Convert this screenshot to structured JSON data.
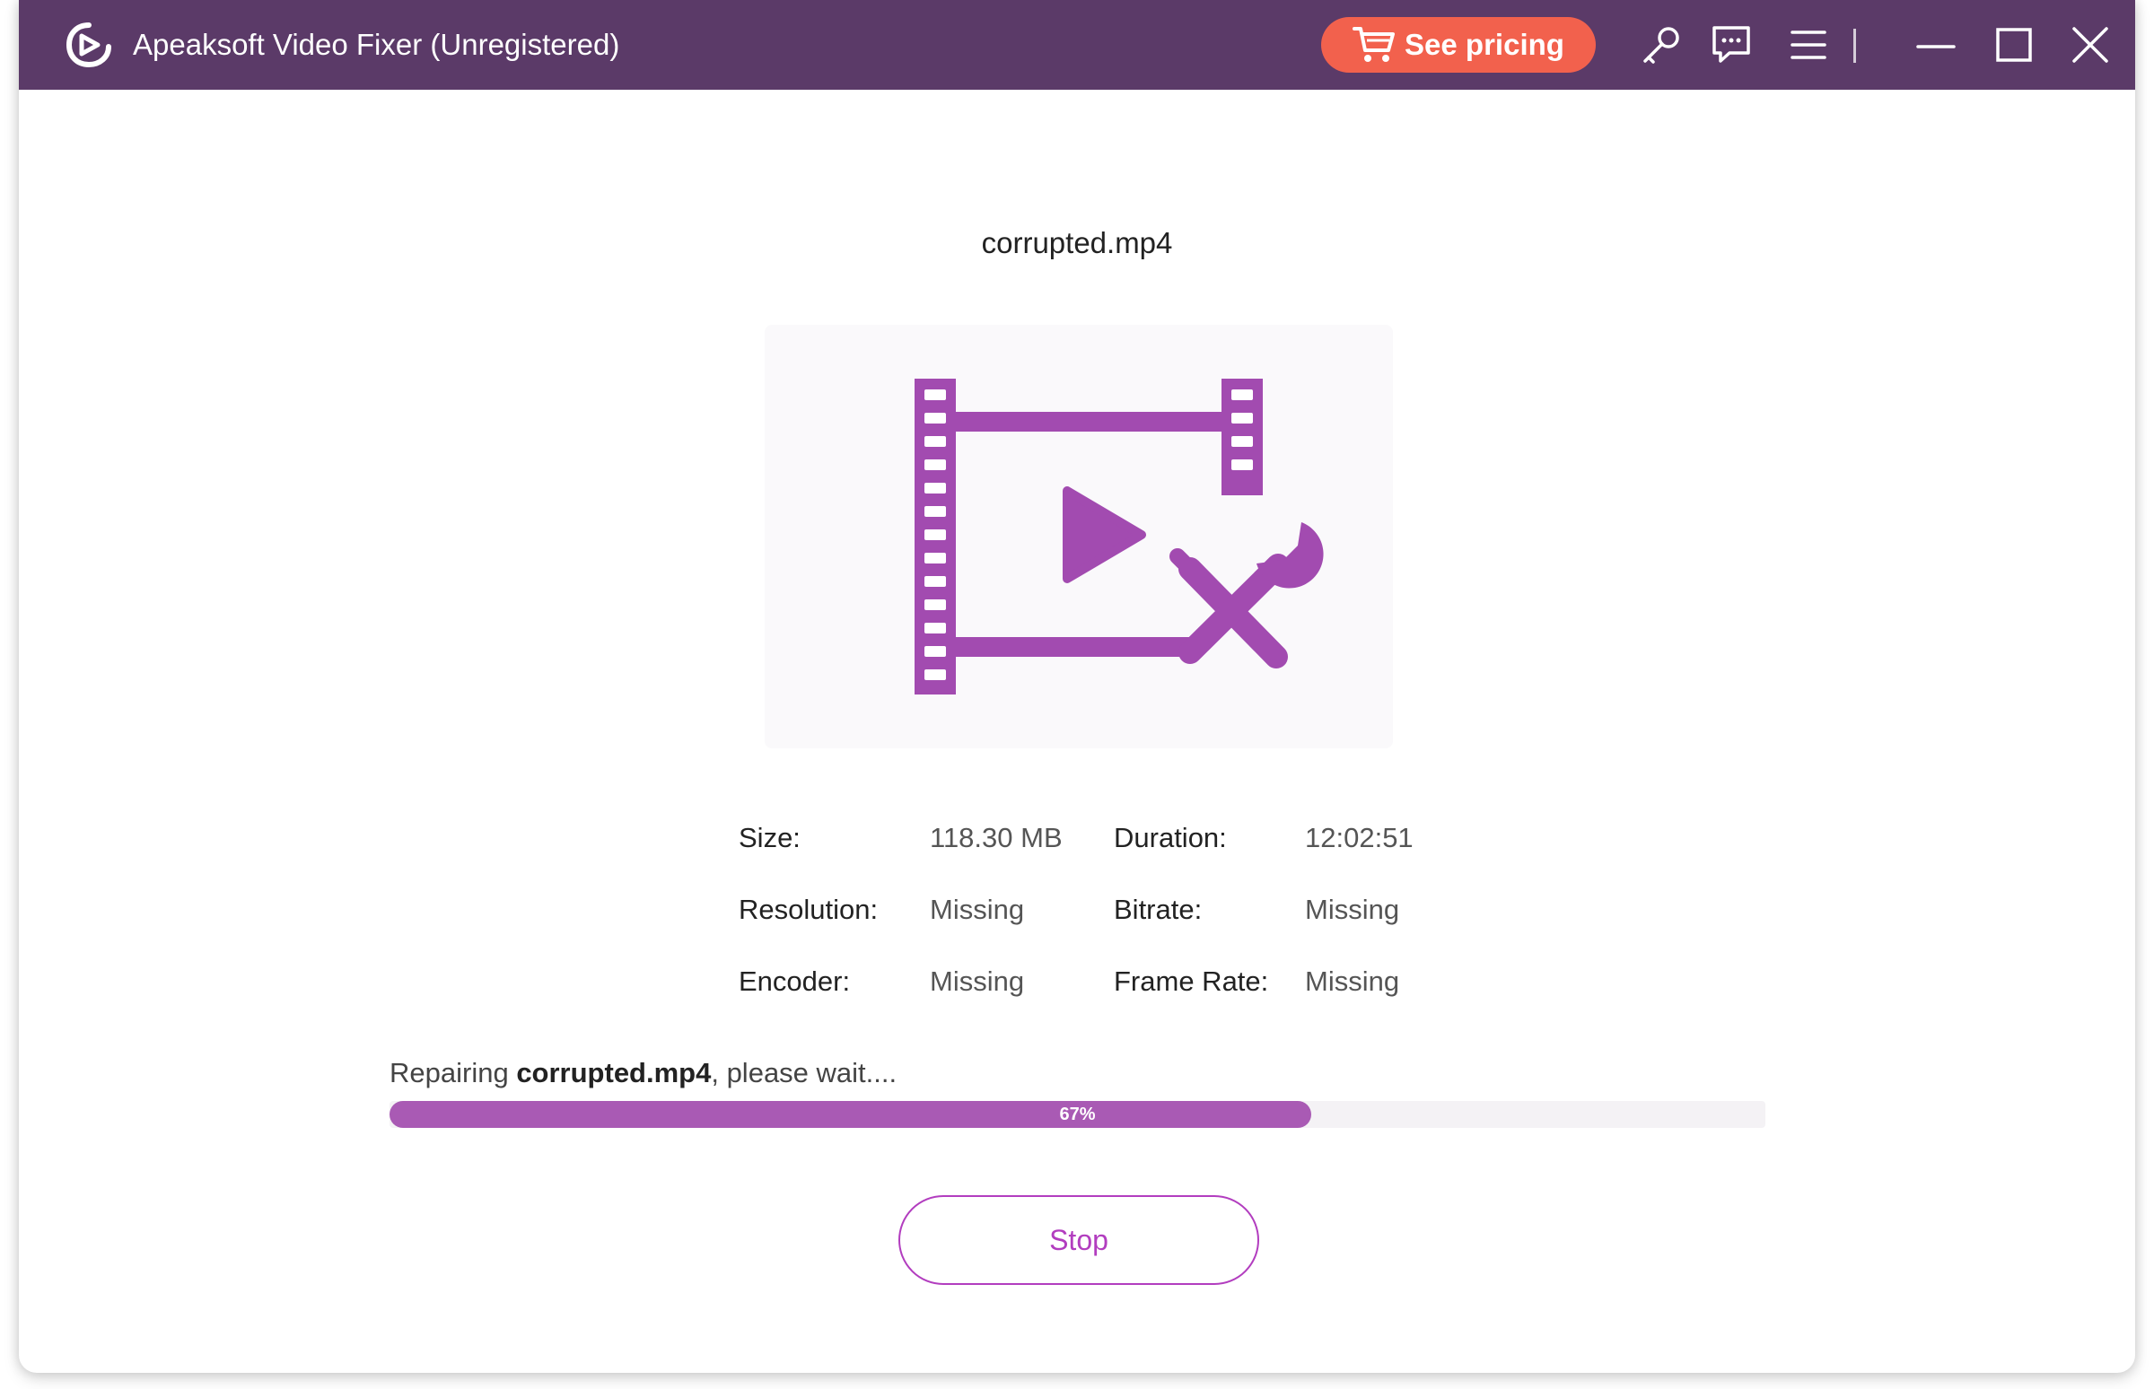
{
  "window": {
    "title": "Apeaksoft Video Fixer (Unregistered)",
    "pricing_label": "See pricing"
  },
  "icons": {
    "logo": "app-logo-icon",
    "cart": "cart-icon",
    "key": "key-icon",
    "feedback": "feedback-icon",
    "menu": "menu-icon",
    "minimize": "minimize-icon",
    "maximize": "maximize-icon",
    "close": "close-icon",
    "thumbnail": "video-repair-icon"
  },
  "file": {
    "name": "corrupted.mp4"
  },
  "info": {
    "size_label": "Size:",
    "size_value": "118.30 MB",
    "duration_label": "Duration:",
    "duration_value": "12:02:51",
    "resolution_label": "Resolution:",
    "resolution_value": "Missing",
    "bitrate_label": "Bitrate:",
    "bitrate_value": "Missing",
    "encoder_label": "Encoder:",
    "encoder_value": "Missing",
    "framerate_label": "Frame Rate:",
    "framerate_value": "Missing"
  },
  "progress": {
    "prefix": "Repairing ",
    "file": "corrupted.mp4",
    "suffix": ", please wait....",
    "percent": 67,
    "percent_label": "67%"
  },
  "actions": {
    "stop_label": "Stop"
  },
  "colors": {
    "titlebar": "#5b3a68",
    "pricing": "#f2614d",
    "accent": "#a95ab4",
    "stop": "#b23dbf"
  }
}
